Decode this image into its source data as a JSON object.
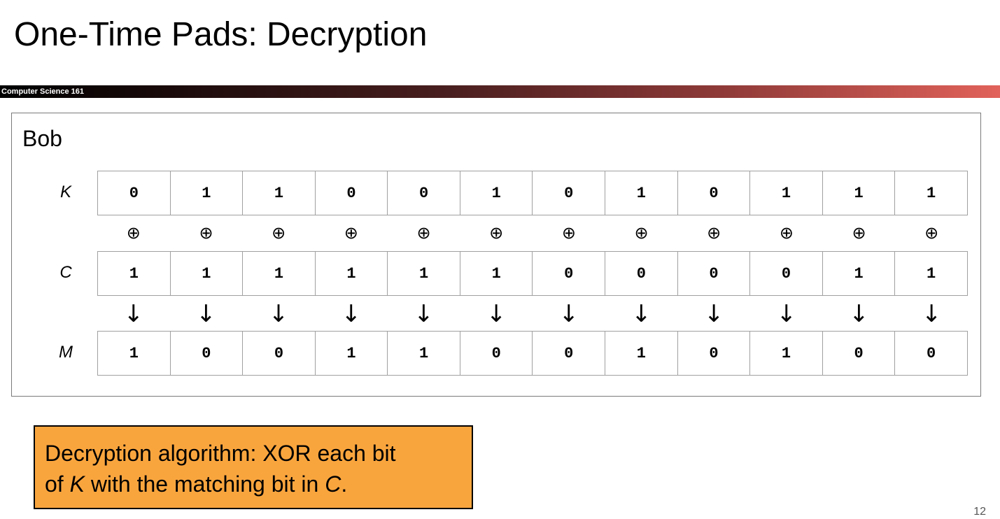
{
  "slide": {
    "title": "One-Time Pads: Decryption",
    "course": "Computer Science 161",
    "page_number": "12"
  },
  "panel": {
    "title": "Bob",
    "rows": {
      "key": {
        "label": "K",
        "bits": [
          "0",
          "1",
          "1",
          "0",
          "0",
          "1",
          "0",
          "1",
          "0",
          "1",
          "1",
          "1"
        ]
      },
      "ciphertext": {
        "label": "C",
        "bits": [
          "1",
          "1",
          "1",
          "1",
          "1",
          "1",
          "0",
          "0",
          "0",
          "0",
          "1",
          "1"
        ]
      },
      "message": {
        "label": "M",
        "bits": [
          "1",
          "0",
          "0",
          "1",
          "1",
          "0",
          "0",
          "1",
          "0",
          "1",
          "0",
          "0"
        ]
      }
    },
    "xor_symbol": "⊕",
    "arrow_symbol": "↓"
  },
  "callout": {
    "line1": "Decryption algorithm: XOR each bit",
    "part1": "of ",
    "k": "K",
    "part2": " with the matching bit in ",
    "c": "C",
    "part3": "."
  },
  "colors": {
    "callout_bg": "#f9a53e",
    "banner_start": "#000000",
    "banner_end": "#e1625a"
  }
}
